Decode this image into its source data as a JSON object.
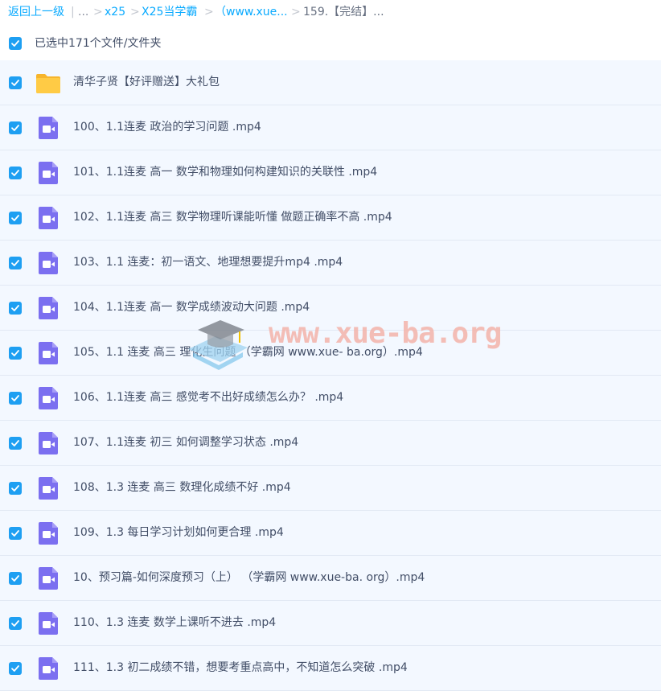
{
  "breadcrumb": {
    "back": "返回上一级",
    "sep1": "|",
    "ellipsis": "...",
    "gt1": ">",
    "c1": "x25",
    "gt2": ">",
    "c2": "X25当学霸",
    "gt3": ">",
    "c3": "（www.xue...",
    "gt4": ">",
    "current": "159.【完结】..."
  },
  "selection": {
    "text": "已选中171个文件/文件夹",
    "checked": true
  },
  "files": [
    {
      "name": "清华子贤【好评赠送】大礼包",
      "type": "folder",
      "checked": true
    },
    {
      "name": "100、1.1连麦 政治的学习问题 .mp4",
      "type": "video",
      "checked": true
    },
    {
      "name": "101、1.1连麦 高一 数学和物理如何构建知识的关联性 .mp4",
      "type": "video",
      "checked": true
    },
    {
      "name": "102、1.1连麦 高三 数学物理听课能听懂 做题正确率不高 .mp4",
      "type": "video",
      "checked": true
    },
    {
      "name": "103、1.1 连麦：初一语文、地理想要提升mp4 .mp4",
      "type": "video",
      "checked": true
    },
    {
      "name": "104、1.1连麦 高一 数学成绩波动大问题 .mp4",
      "type": "video",
      "checked": true
    },
    {
      "name": "105、1.1 连麦 高三 理化生问题 （学霸网 www.xue- ba.org）.mp4",
      "type": "video",
      "checked": true
    },
    {
      "name": "106、1.1连麦 高三 感觉考不出好成绩怎么办？ .mp4",
      "type": "video",
      "checked": true
    },
    {
      "name": "107、1.1连麦 初三 如何调整学习状态 .mp4",
      "type": "video",
      "checked": true
    },
    {
      "name": "108、1.3 连麦 高三 数理化成绩不好 .mp4",
      "type": "video",
      "checked": true
    },
    {
      "name": "109、1.3 每日学习计划如何更合理 .mp4",
      "type": "video",
      "checked": true
    },
    {
      "name": "10、预习篇-如何深度预习（上） （学霸网 www.xue-ba. org）.mp4",
      "type": "video",
      "checked": true
    },
    {
      "name": "110、1.3 连麦 数学上课听不进去 .mp4",
      "type": "video",
      "checked": true
    },
    {
      "name": "111、1.3 初二成绩不错，想要考重点高中，不知道怎么突破 .mp4",
      "type": "video",
      "checked": true
    }
  ],
  "watermark": {
    "text": "www.xue-ba.org"
  },
  "colors": {
    "accent": "#1e9ff2",
    "link": "#09aaff",
    "row_bg": "#f3f8ff",
    "video_icon": "#7b6ff0",
    "folder_icon": "#ffc53d"
  }
}
